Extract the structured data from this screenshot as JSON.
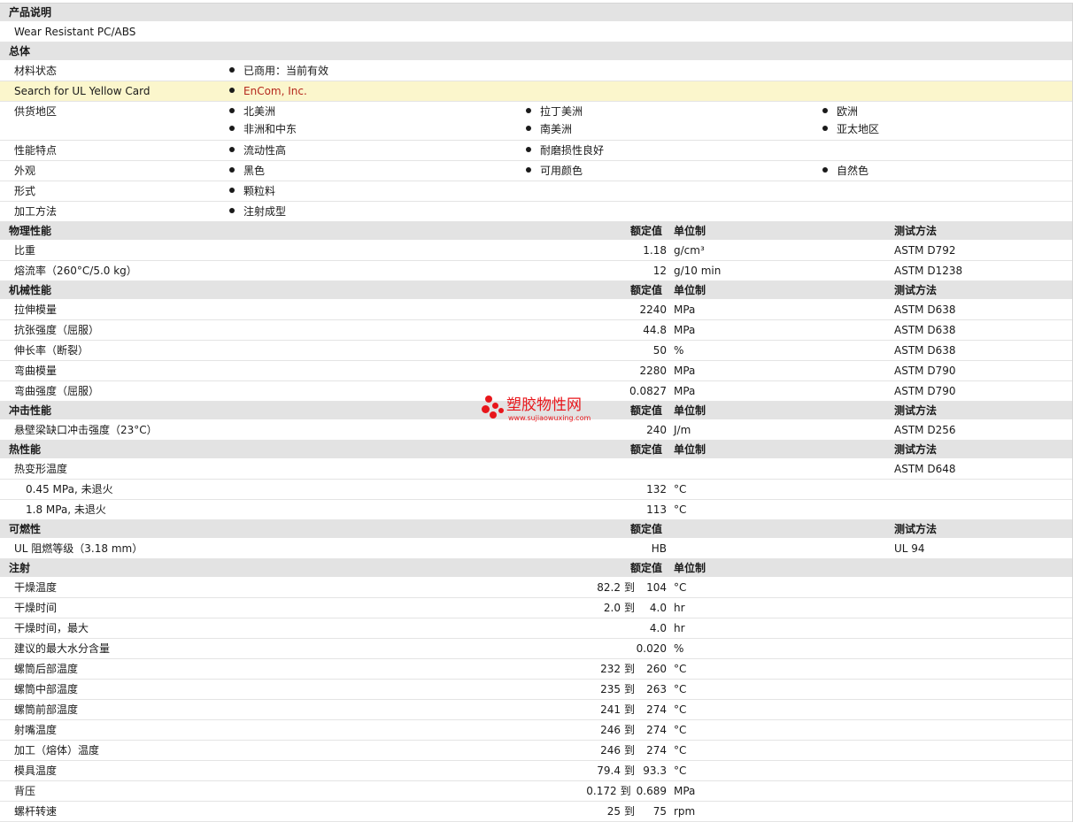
{
  "product": {
    "section_title": "产品说明",
    "description": "Wear Resistant PC/ABS"
  },
  "general": {
    "section_title": "总体",
    "material_status_label": "材料状态",
    "material_status_value": "已商用：当前有效",
    "ul_label": "Search for UL Yellow Card",
    "ul_value": "EnCom, Inc.",
    "supply_label": "供货地区",
    "supply_values": [
      "北美洲",
      "拉丁美洲",
      "欧洲",
      "非洲和中东",
      "南美洲",
      "亚太地区"
    ],
    "features_label": "性能特点",
    "features_values": [
      "流动性高",
      "耐磨损性良好"
    ],
    "appearance_label": "外观",
    "appearance_values": [
      "黑色",
      "可用颜色",
      "自然色"
    ],
    "form_label": "形式",
    "form_value": "颗粒料",
    "processing_label": "加工方法",
    "processing_value": "注射成型"
  },
  "headers": {
    "value": "额定值",
    "unit": "单位制",
    "method": "测试方法"
  },
  "physical": {
    "section_title": "物理性能",
    "rows": [
      {
        "label": "比重",
        "value": "1.18",
        "unit": "g/cm³",
        "method": "ASTM D792"
      },
      {
        "label": "熔流率（260°C/5.0 kg）",
        "value": "12",
        "unit": "g/10 min",
        "method": "ASTM D1238"
      }
    ]
  },
  "mechanical": {
    "section_title": "机械性能",
    "rows": [
      {
        "label": "拉伸模量",
        "value": "2240",
        "unit": "MPa",
        "method": "ASTM D638"
      },
      {
        "label": "抗张强度（屈服）",
        "value": "44.8",
        "unit": "MPa",
        "method": "ASTM D638"
      },
      {
        "label": "伸长率（断裂）",
        "value": "50",
        "unit": "%",
        "method": "ASTM D638"
      },
      {
        "label": "弯曲模量",
        "value": "2280",
        "unit": "MPa",
        "method": "ASTM D790"
      },
      {
        "label": "弯曲强度（屈服）",
        "value": "0.0827",
        "unit": "MPa",
        "method": "ASTM D790"
      }
    ]
  },
  "impact": {
    "section_title": "冲击性能",
    "rows": [
      {
        "label": "悬壁梁缺口冲击强度（23°C）",
        "value": "240",
        "unit": "J/m",
        "method": "ASTM D256"
      }
    ]
  },
  "thermal": {
    "section_title": "热性能",
    "hdt_label": "热变形温度",
    "hdt_method": "ASTM D648",
    "rows": [
      {
        "label": "0.45 MPa, 未退火",
        "value": "132",
        "unit": "°C"
      },
      {
        "label": "1.8 MPa, 未退火",
        "value": "113",
        "unit": "°C"
      }
    ]
  },
  "flammability": {
    "section_title": "可燃性",
    "rows": [
      {
        "label": "UL 阻燃等级（3.18 mm）",
        "value": "HB",
        "method": "UL 94"
      }
    ]
  },
  "injection": {
    "section_title": "注射",
    "range_word": "到",
    "rows": [
      {
        "label": "干燥温度",
        "v1": "82.2",
        "v2": "104",
        "unit": "°C"
      },
      {
        "label": "干燥时间",
        "v1": "2.0",
        "v2": "4.0",
        "unit": "hr"
      },
      {
        "label": "干燥时间，最大",
        "v1": "",
        "v2": "4.0",
        "unit": "hr"
      },
      {
        "label": "建议的最大水分含量",
        "v1": "",
        "v2": "0.020",
        "unit": "%"
      },
      {
        "label": "螺筒后部温度",
        "v1": "232",
        "v2": "260",
        "unit": "°C"
      },
      {
        "label": "螺筒中部温度",
        "v1": "235",
        "v2": "263",
        "unit": "°C"
      },
      {
        "label": "螺筒前部温度",
        "v1": "241",
        "v2": "274",
        "unit": "°C"
      },
      {
        "label": "射嘴温度",
        "v1": "246",
        "v2": "274",
        "unit": "°C"
      },
      {
        "label": "加工（熔体）温度",
        "v1": "246",
        "v2": "274",
        "unit": "°C"
      },
      {
        "label": "模具温度",
        "v1": "79.4",
        "v2": "93.3",
        "unit": "°C"
      },
      {
        "label": "背压",
        "v1": "0.172",
        "v2": "0.689",
        "unit": "MPa"
      },
      {
        "label": "螺杆转速",
        "v1": "25",
        "v2": "75",
        "unit": "rpm"
      }
    ]
  },
  "watermark": {
    "text": "塑胶物性网",
    "url": "www.sujiaowuxing.com",
    "color": "#e8161b"
  }
}
